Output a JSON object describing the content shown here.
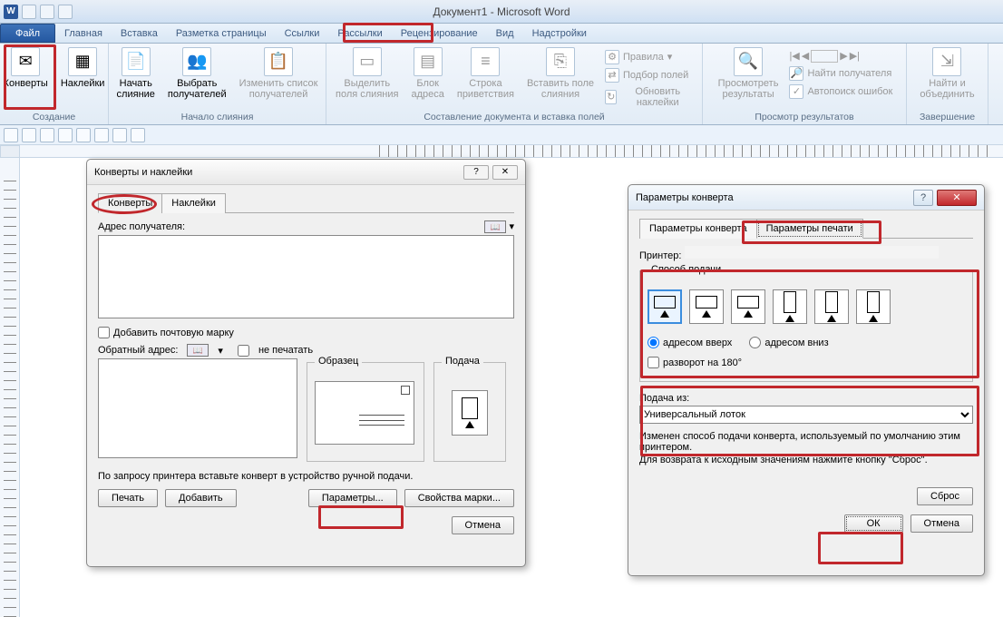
{
  "title_bar": {
    "doc_title": "Документ1 - Microsoft Word"
  },
  "tabs": {
    "file": "Файл",
    "home": "Главная",
    "insert": "Вставка",
    "layout": "Разметка страницы",
    "references": "Ссылки",
    "mailings": "Рассылки",
    "review": "Рецензирование",
    "view": "Вид",
    "addins": "Надстройки"
  },
  "ribbon": {
    "group_create": "Создание",
    "envelopes": "Конверты",
    "labels": "Наклейки",
    "group_start": "Начало слияния",
    "start_merge": "Начать\nслияние",
    "select_recipients": "Выбрать\nполучателей",
    "edit_recipients": "Изменить список\nполучателей",
    "group_write": "Составление документа и вставка полей",
    "highlight_fields": "Выделить\nполя слияния",
    "address_block": "Блок\nадреса",
    "greeting_line": "Строка\nприветствия",
    "insert_field": "Вставить поле\nслияния",
    "rules": "Правила",
    "match_fields": "Подбор полей",
    "update_labels": "Обновить наклейки",
    "group_preview": "Просмотр результатов",
    "preview_results": "Просмотреть\nрезультаты",
    "find_recipient": "Найти получателя",
    "auto_check": "Автопоиск ошибок",
    "group_finish": "Завершение",
    "finish_merge": "Найти и\nобъединить"
  },
  "dialog1": {
    "title": "Конверты и наклейки",
    "tab_envelopes": "Конверты",
    "tab_labels": "Наклейки",
    "recipient_label": "Адрес получателя:",
    "add_stamp": "Добавить почтовую марку",
    "return_label": "Обратный адрес:",
    "no_print": "не печатать",
    "sample": "Образец",
    "feed": "Подача",
    "hint": "По запросу принтера вставьте конверт в устройство ручной подачи.",
    "btn_print": "Печать",
    "btn_add": "Добавить",
    "btn_params": "Параметры...",
    "btn_stamp_props": "Свойства марки...",
    "btn_cancel": "Отмена"
  },
  "dialog2": {
    "title": "Параметры конверта",
    "tab_envelope_params": "Параметры конверта",
    "tab_print_params": "Параметры печати",
    "printer_label": "Принтер:",
    "feed_method": "Способ подачи",
    "address_up": "адресом вверх",
    "address_down": "адресом вниз",
    "rotate_180": "разворот на 180°",
    "feed_from": "Подача из:",
    "tray": "Универсальный лоток",
    "changed_note": "Изменен способ подачи конверта, используемый по умолчанию этим принтером.",
    "reset_note": "Для возврата к исходным значениям нажмите кнопку \"Сброс\".",
    "btn_reset": "Сброс",
    "btn_ok": "ОК",
    "btn_cancel": "Отмена"
  }
}
